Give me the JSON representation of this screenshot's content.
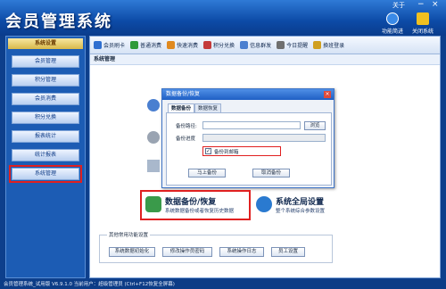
{
  "app": {
    "title": "会员管理系统"
  },
  "window": {
    "about_label": "关于",
    "minimize": "−",
    "close": "×"
  },
  "top_tools": [
    {
      "label": "功能简进",
      "icon": "info-icon"
    },
    {
      "label": "关闭系统",
      "icon": "warning-icon"
    }
  ],
  "sidebar": {
    "header": "系统设置",
    "items": [
      "会员管理",
      "积分管理",
      "会员消费",
      "积分兑换",
      "报表统计",
      "统计报表",
      "系统管理"
    ]
  },
  "toolbar": {
    "items": [
      {
        "label": "会员刷卡",
        "icon": "card-icon",
        "color": "#2f6fd0"
      },
      {
        "label": "普通消费",
        "icon": "money-icon",
        "color": "#2f9a3a"
      },
      {
        "label": "快速消费",
        "icon": "lightning-icon",
        "color": "#e08a20"
      },
      {
        "label": "积分兑换",
        "icon": "gift-icon",
        "color": "#c43a3a"
      },
      {
        "label": "信息群发",
        "icon": "mail-icon",
        "color": "#4a7fd0"
      },
      {
        "label": "今日提醒",
        "icon": "clock-icon",
        "color": "#6f6f6f"
      },
      {
        "label": "换班登录",
        "icon": "lock-icon",
        "color": "#d0a020"
      }
    ]
  },
  "section_title": "系统管理",
  "dialog": {
    "title": "数据备份/恢复",
    "tabs": [
      "数据备份",
      "数据恢复"
    ],
    "path_label": "备份路径:",
    "path_value": "",
    "browse": "浏览",
    "progress_label": "备份进度",
    "checkbox_label": "备份到邮箱",
    "checkbox_checked": true,
    "start": "马上备份",
    "cancel": "取消备份"
  },
  "tiles": [
    {
      "title": "数据备份/恢复",
      "subtitle": "系统数据备份或者恢复历史数据",
      "icon": "database-icon",
      "color": "#3a9a4a"
    },
    {
      "title": "系统全局设置",
      "subtitle": "整个系统综合参数设置",
      "icon": "globe-icon",
      "color": "#2a7ad0"
    }
  ],
  "other": {
    "label": "其他常用功能设置",
    "buttons": [
      "系统数据初始化",
      "修改操作员密码",
      "系统操作日志",
      "员工设置"
    ]
  },
  "status": {
    "text": "会员管理系统_试用版 V6.9.1.0 当前用户：超级管理员 (Ctrl+F12恢复全屏幕)"
  }
}
